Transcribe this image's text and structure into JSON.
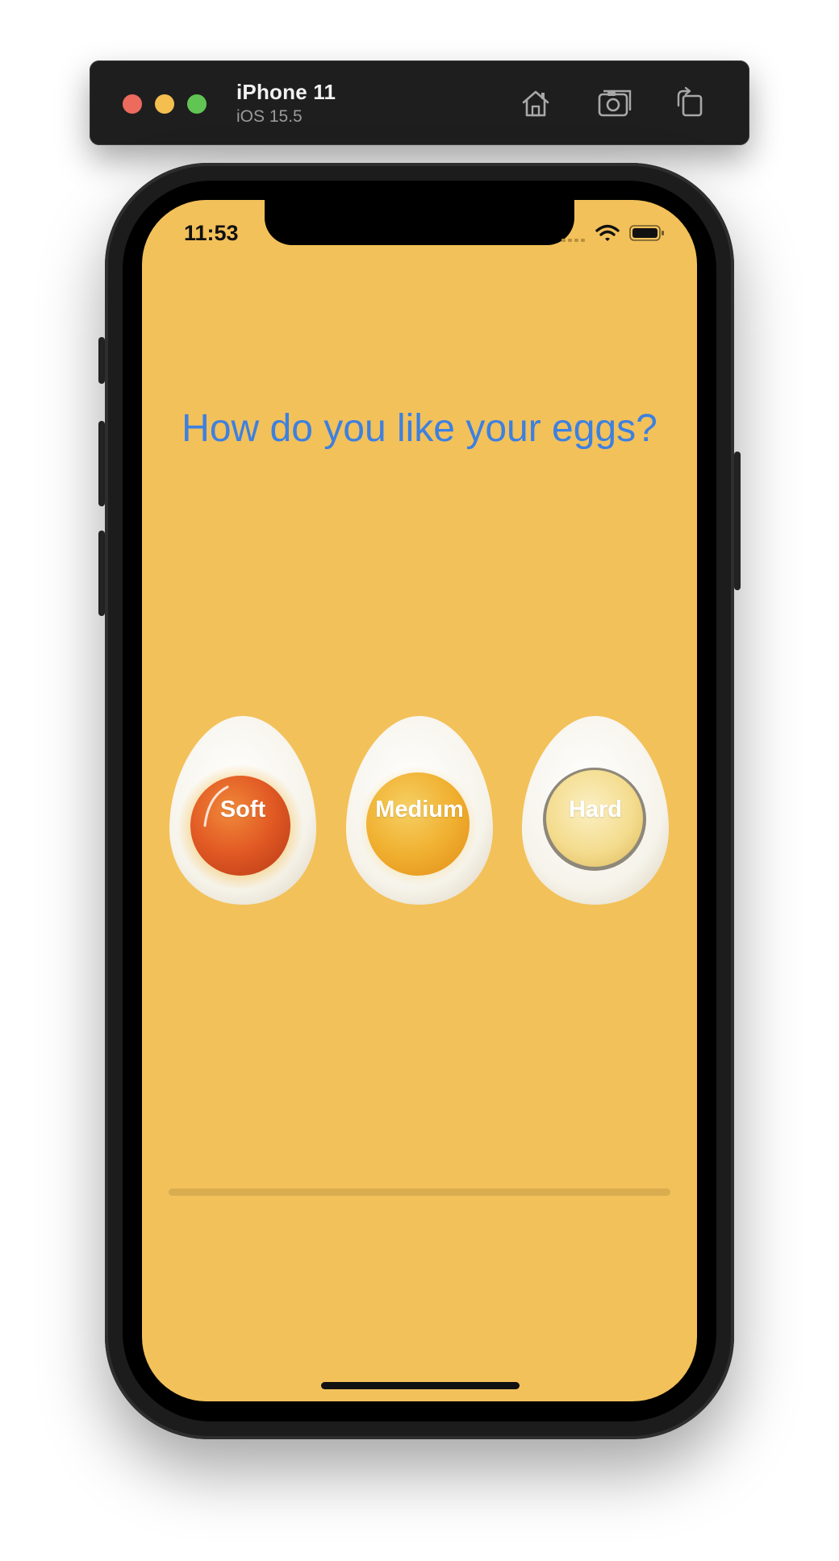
{
  "simulator": {
    "device_name": "iPhone 11",
    "os_version": "iOS 15.5",
    "toolbar_icons": [
      "home-icon",
      "screenshot-icon",
      "rotate-icon"
    ]
  },
  "status_bar": {
    "time": "11:53",
    "icons": [
      "cellular-signal-icon",
      "wifi-icon",
      "battery-icon"
    ]
  },
  "app": {
    "background_color": "#f3c15a",
    "title": "How do you like your eggs?",
    "title_color": "#3d80e0",
    "eggs": [
      {
        "label": "Soft",
        "yolk_color": "#e25a24"
      },
      {
        "label": "Medium",
        "yolk_color": "#f0b030"
      },
      {
        "label": "Hard",
        "yolk_color": "#f4dc8e"
      }
    ],
    "progress": 0
  }
}
